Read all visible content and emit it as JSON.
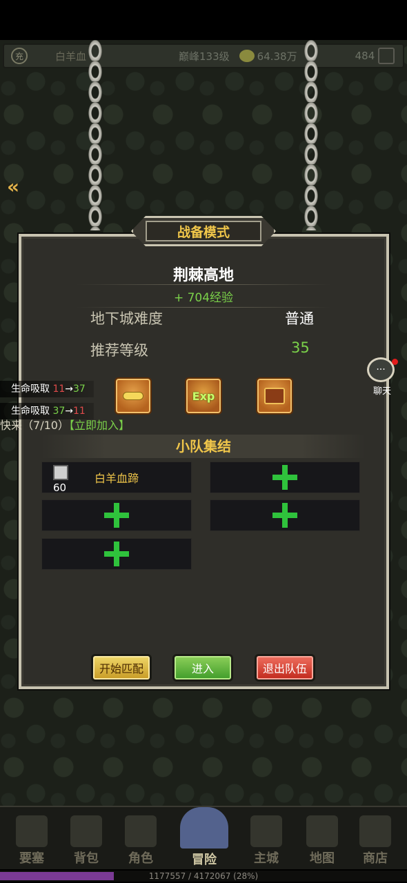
{
  "top_bar": {
    "badge": "充",
    "player_name": "白羊血",
    "peak_level": "巅峰133级",
    "money": "64.38万",
    "gems": "484"
  },
  "panel": {
    "title": "战备模式",
    "dungeon_name": "荆棘高地",
    "exp_reward": "+ 704经验",
    "difficulty_label": "地下城难度",
    "difficulty_value": "普通",
    "recommended_label": "推荐等级",
    "recommended_value": "35",
    "rewards": [
      {
        "icon": "gold-bar-icon"
      },
      {
        "icon": "exp-icon",
        "text": "Exp"
      },
      {
        "icon": "treasure-chest-icon"
      }
    ],
    "squad_title": "小队集结",
    "slots": [
      {
        "member": true,
        "name": "白羊血蹄",
        "level": "60"
      },
      {
        "member": false
      },
      {
        "member": false
      },
      {
        "member": false
      },
      {
        "member": false
      }
    ],
    "buttons": {
      "match": "开始匹配",
      "enter": "进入",
      "exit": "退出队伍"
    }
  },
  "lifesteal": [
    {
      "label": "生命吸取",
      "old": "11",
      "arrow": "→",
      "new": "37"
    },
    {
      "label": "生命吸取",
      "old": "37",
      "arrow": "→",
      "new": "11"
    }
  ],
  "ticker": {
    "prefix": "快来（",
    "count": "7/10",
    "suffix": "）",
    "join": "【立即加入】"
  },
  "chat": {
    "label": "聊天"
  },
  "nav": [
    {
      "label": "要塞",
      "icon": "fortress-icon",
      "active": false
    },
    {
      "label": "背包",
      "icon": "backpack-icon",
      "active": false
    },
    {
      "label": "角色",
      "icon": "character-icon",
      "active": false
    },
    {
      "label": "冒险",
      "icon": "portal-icon",
      "active": true
    },
    {
      "label": "主城",
      "icon": "castle-icon",
      "active": false
    },
    {
      "label": "地图",
      "icon": "scroll-map-icon",
      "active": false
    },
    {
      "label": "商店",
      "icon": "shop-icon",
      "active": false
    }
  ],
  "xp": {
    "text": "1177557 / 4172067 (28%)",
    "fraction": 0.28
  },
  "colors": {
    "accent_gold": "#f0c64a",
    "exp_green": "#7bd24a",
    "loss_red": "#e14b4b",
    "plus_green": "#2fc23c"
  }
}
